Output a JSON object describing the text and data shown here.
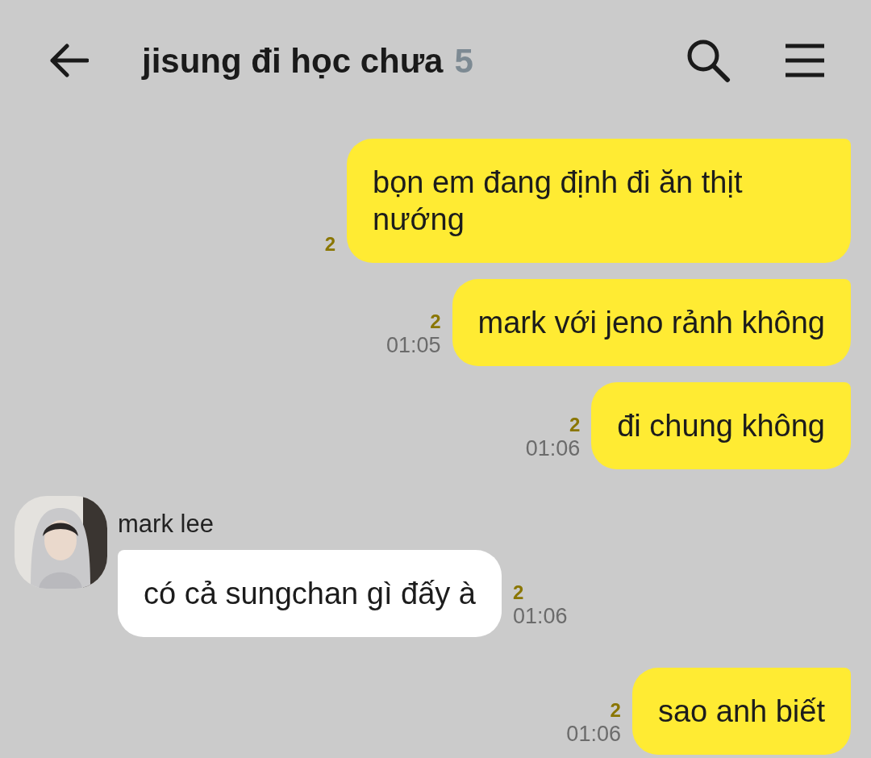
{
  "header": {
    "title": "jisung đi học chưa",
    "member_count": "5"
  },
  "messages": [
    {
      "kind": "sent",
      "text": "bọn em đang định đi ăn thịt nướng",
      "unread": "2"
    },
    {
      "kind": "sent",
      "text": "mark với jeno rảnh không",
      "unread": "2",
      "time": "01:05"
    },
    {
      "kind": "sent",
      "text": "đi chung không",
      "unread": "2",
      "time": "01:06"
    },
    {
      "kind": "received",
      "sender": "mark lee",
      "text": "có cả sungchan gì đấy à",
      "unread": "2",
      "time": "01:06"
    },
    {
      "kind": "sent",
      "text": "sao anh biết",
      "unread": "2",
      "time": "01:06"
    }
  ]
}
